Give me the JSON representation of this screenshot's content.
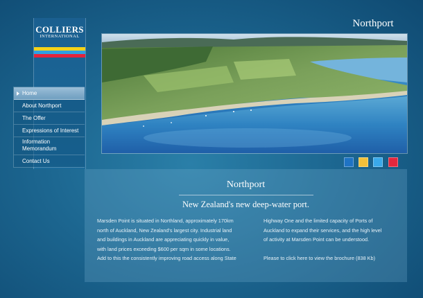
{
  "brand": {
    "name_line1": "COLLIERS",
    "name_line2": "INTERNATIONAL",
    "colors": {
      "yellow": "#f3d21a",
      "blue": "#2f9fe2",
      "red": "#e4233b"
    }
  },
  "header": {
    "title": "Northport"
  },
  "nav": {
    "items": [
      {
        "label": "Home",
        "active": true
      },
      {
        "label": "About Northport"
      },
      {
        "label": "The Offer"
      },
      {
        "label": "Expressions of Interest"
      },
      {
        "label": "Information Memorandum"
      },
      {
        "label": "Contact Us"
      }
    ]
  },
  "swatches": [
    "#1f73c4",
    "#f2c03a",
    "#3aa9ea",
    "#e3273d"
  ],
  "content": {
    "title": "Northport",
    "subtitle": "New Zealand's new deep-water port.",
    "para_left_lines": [
      "Marsden Point is situated in Northland, approximately 170km",
      "north of Auckland, New Zealand's largest city. Industrial land",
      "and buildings in Auckland are appreciating quickly in value,",
      "with land prices exceeding $600 per sqm in some locations.",
      "Add to this the consistently improving road access along State"
    ],
    "para_right_lines": [
      "Highway One and the limited capacity of Ports of",
      "Auckland to expand their services, and the high level",
      "of activity at Marsden Point can be understood."
    ],
    "brochure_link": "Please to click here to view the brochure (838 Kb)"
  }
}
